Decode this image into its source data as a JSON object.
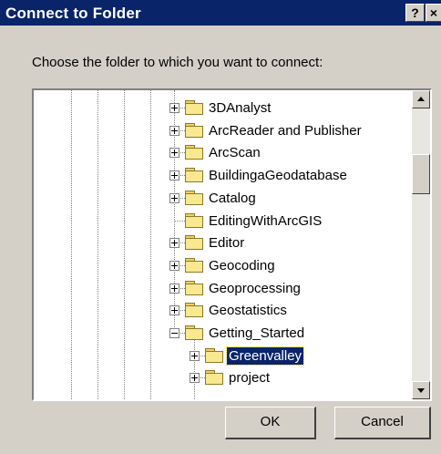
{
  "window": {
    "title": "Connect to Folder",
    "help_label": "?",
    "close_label": "×"
  },
  "prompt": "Choose the folder to which you want to connect:",
  "tree": {
    "items": [
      {
        "label": "3DAnalyst",
        "expander": "plus",
        "selected": false
      },
      {
        "label": "ArcReader and Publisher",
        "expander": "plus",
        "selected": false
      },
      {
        "label": "ArcScan",
        "expander": "plus",
        "selected": false
      },
      {
        "label": "BuildingaGeodatabase",
        "expander": "plus",
        "selected": false
      },
      {
        "label": "Catalog",
        "expander": "plus",
        "selected": false
      },
      {
        "label": "EditingWithArcGIS",
        "expander": "none",
        "selected": false
      },
      {
        "label": "Editor",
        "expander": "plus",
        "selected": false
      },
      {
        "label": "Geocoding",
        "expander": "plus",
        "selected": false
      },
      {
        "label": "Geoprocessing",
        "expander": "plus",
        "selected": false
      },
      {
        "label": "Geostatistics",
        "expander": "plus",
        "selected": false
      },
      {
        "label": "Getting_Started",
        "expander": "minus",
        "selected": false
      },
      {
        "label": "Greenvalley",
        "expander": "plus",
        "selected": true
      },
      {
        "label": "project",
        "expander": "plus",
        "selected": false
      }
    ]
  },
  "buttons": {
    "ok_label": "OK",
    "cancel_label": "Cancel"
  },
  "colors": {
    "titlebar": "#0a246a",
    "dialog_face": "#d4d0c8",
    "selection": "#0a246a",
    "folder": "#f8e890"
  }
}
